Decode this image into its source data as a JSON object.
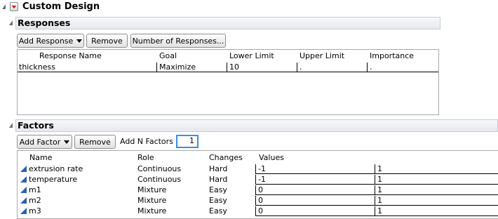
{
  "custom_design": {
    "title": "Custom Design"
  },
  "responses": {
    "title": "Responses",
    "buttons": {
      "add_response": "Add Response",
      "remove": "Remove",
      "number_of_responses": "Number of Responses..."
    },
    "columns": [
      "Response Name",
      "Goal",
      "Lower Limit",
      "Upper Limit",
      "Importance"
    ],
    "rows": [
      {
        "name": "thickness",
        "goal": "Maximize",
        "lower": "10",
        "upper": ".",
        "importance": "."
      }
    ]
  },
  "factors": {
    "title": "Factors",
    "buttons": {
      "add_factor": "Add Factor",
      "remove": "Remove"
    },
    "add_n_label": "Add N Factors",
    "add_n_value": "1",
    "columns": [
      "Name",
      "Role",
      "Changes",
      "Values"
    ],
    "rows": [
      {
        "name": "extrusion rate",
        "role": "Continuous",
        "changes": "Hard",
        "low": "-1",
        "high": "1"
      },
      {
        "name": "temperature",
        "role": "Continuous",
        "changes": "Hard",
        "low": "-1",
        "high": "1"
      },
      {
        "name": "m1",
        "role": "Mixture",
        "changes": "Easy",
        "low": "0",
        "high": "1"
      },
      {
        "name": "m2",
        "role": "Mixture",
        "changes": "Easy",
        "low": "0",
        "high": "1"
      },
      {
        "name": "m3",
        "role": "Mixture",
        "changes": "Easy",
        "low": "0",
        "high": "1"
      }
    ]
  }
}
